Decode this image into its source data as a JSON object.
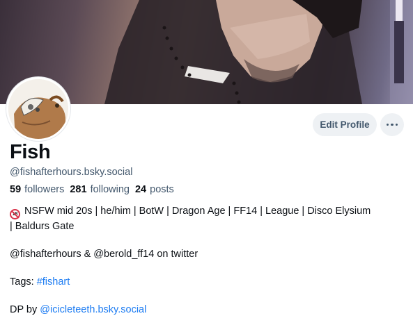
{
  "profile": {
    "display_name": "Fish",
    "handle": "@fishafterhours.bsky.social",
    "edit_profile_label": "Edit Profile",
    "more_options_icon": "ellipsis-icon",
    "avatar_icon": "avatar-image",
    "banner_icon": "banner-image"
  },
  "stats": {
    "followers_count": "59",
    "followers_label": "followers",
    "following_count": "281",
    "following_label": "following",
    "posts_count": "24",
    "posts_label": "posts"
  },
  "bio": {
    "line1_icon": "no-under-18-icon",
    "line1_text": "NSFW mid 20s | he/him | BotW | Dragon Age | FF14 | League | Disco Elysium",
    "line2_text": "| Baldurs Gate",
    "line3_text": "@fishafterhours & @berold_ff14 on twitter",
    "tags_prefix": "Tags: ",
    "tag_link": "#fishart",
    "dp_prefix": "DP by ",
    "dp_link": "@icicleteeth.bsky.social"
  },
  "colors": {
    "link": "#1d7cf2",
    "muted_text": "#42576c",
    "button_bg": "#eef1f4"
  }
}
